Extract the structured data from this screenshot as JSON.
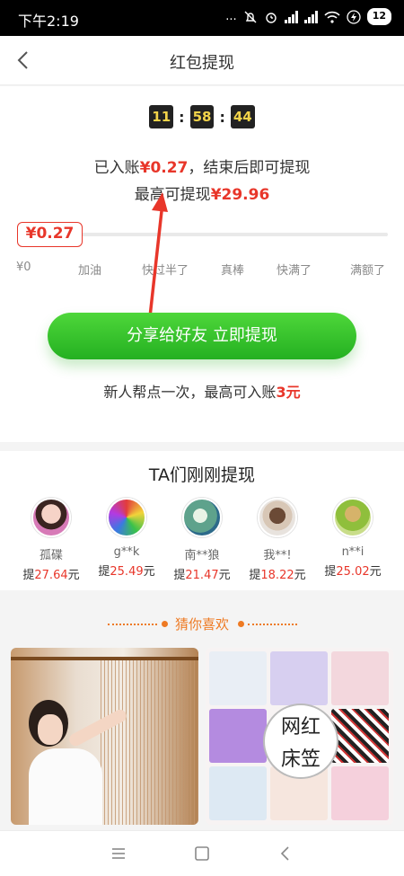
{
  "status_bar": {
    "time": "下午2:19",
    "dots": "...",
    "battery": "12"
  },
  "nav": {
    "title": "红包提现"
  },
  "countdown": {
    "hours": "11",
    "minutes": "58",
    "seconds": "44",
    "separator": ":"
  },
  "balance": {
    "prefix": "已入账",
    "amount": "¥0.27",
    "suffix": "，结束后即可提现",
    "max_prefix": "最高可提现",
    "max_amount": "¥29.96"
  },
  "progress": {
    "current_label": "¥0.27",
    "fraction": 0.009,
    "milestones": [
      "¥0",
      "加油",
      "快过半了",
      "真棒",
      "快满了",
      "满额了"
    ]
  },
  "cta": {
    "label": "分享给好友 立即提现",
    "note_prefix": "新人帮点一次，最高可入账",
    "note_amount": "3元"
  },
  "recent": {
    "title": "TA们刚刚提现",
    "users": [
      {
        "name": "孤碟",
        "prefix": "提",
        "amount": "27.64",
        "unit": "元"
      },
      {
        "name": "g**k",
        "prefix": "提",
        "amount": "25.49",
        "unit": "元"
      },
      {
        "name": "南**狼",
        "prefix": "提",
        "amount": "21.47",
        "unit": "元"
      },
      {
        "name": "我**!",
        "prefix": "提",
        "amount": "18.22",
        "unit": "元"
      },
      {
        "name": "n**i",
        "prefix": "提",
        "amount": "25.02",
        "unit": "元"
      }
    ]
  },
  "guess": {
    "title": "猜你喜欢"
  },
  "products": [
    {
      "image": "string curtain photo",
      "badge": ""
    },
    {
      "image": "fitted sheet collage",
      "badge_line1": "网红",
      "badge_line2": "床笠"
    }
  ],
  "colors": {
    "accent_red": "#e8362a",
    "cta_green": "#2bbd28",
    "guess_orange": "#ee7a23",
    "countdown_digit": "#f3d44a"
  },
  "icons": {
    "back": "chevron-left-icon",
    "menu": "menu-icon",
    "home": "square-home-icon",
    "back_nav": "triangle-back-icon"
  }
}
